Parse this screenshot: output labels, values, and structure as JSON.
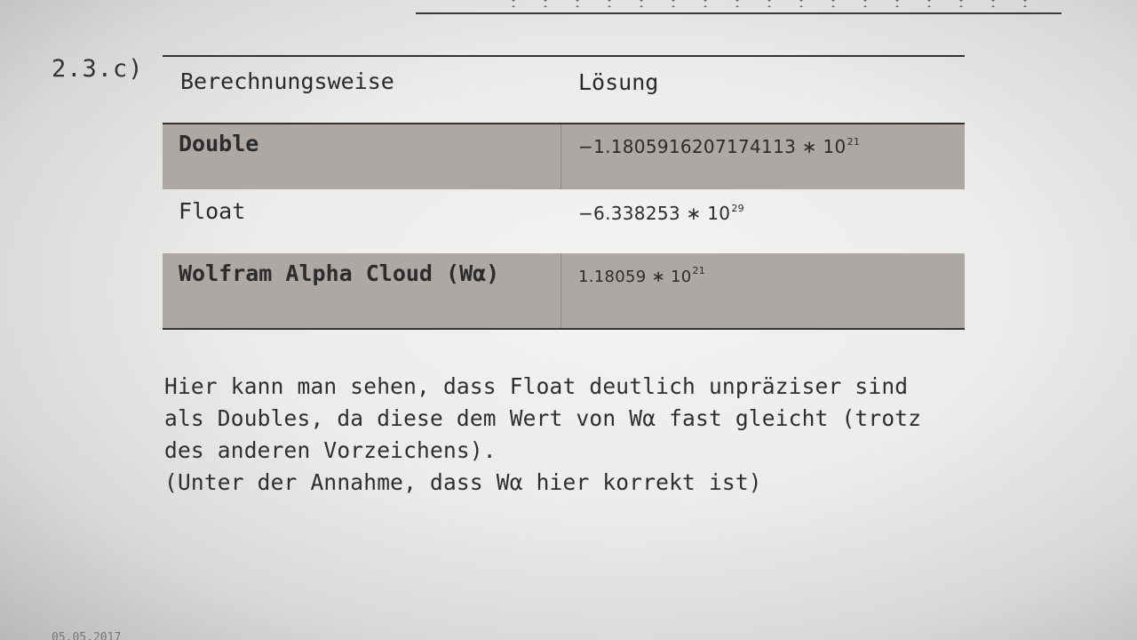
{
  "section": {
    "label": "2.3.c)"
  },
  "table": {
    "headers": [
      "Berechnungsweise",
      "Lösung"
    ],
    "rows": [
      {
        "method": "Double",
        "mantissa": "−1.1805916207174113 ∗ 10",
        "exponent": "21",
        "shaded": true
      },
      {
        "method": "Float",
        "mantissa": "−6.338253 ∗ 10",
        "exponent": "29",
        "shaded": false
      },
      {
        "method": "Wolfram Alpha Cloud (Wα)",
        "mantissa": "1.18059 ∗ 10",
        "exponent": "21",
        "shaded": true
      }
    ]
  },
  "paragraph": {
    "lines": [
      "Hier kann man sehen, dass Float deutlich unpräziser sind",
      "als Doubles, da diese dem Wert von Wα fast gleicht (trotz",
      "des anderen Vorzeichens).",
      "(Unter der Annahme, dass Wα hier korrekt ist)"
    ]
  },
  "footer": {
    "date": "05.05.2017"
  },
  "colors": {
    "shaded_row": "#ada8a3",
    "text": "#2a2a2a",
    "rule": "#333333"
  }
}
